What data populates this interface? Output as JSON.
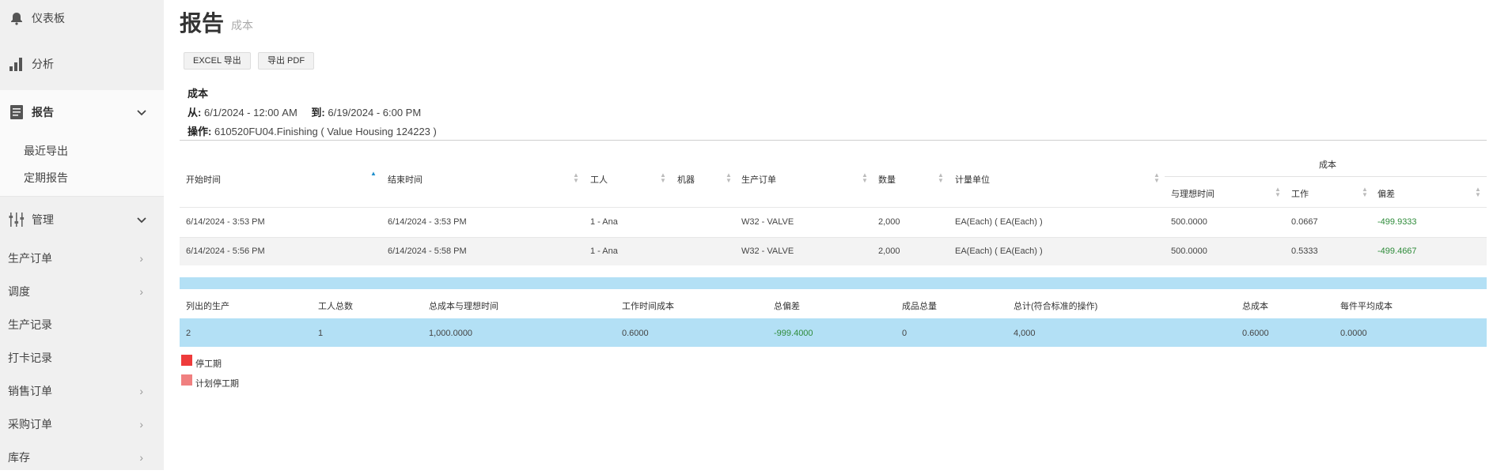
{
  "sidebar": {
    "dashboard": "仪表板",
    "analysis": "分析",
    "reports": "报告",
    "reports_sub": [
      "最近导出",
      "定期报告"
    ],
    "manage": "管理",
    "items": [
      "生产订单",
      "调度",
      "生产记录",
      "打卡记录",
      "销售订单",
      "采购订单",
      "库存"
    ]
  },
  "header": {
    "title": "报告",
    "subtitle": "成本"
  },
  "buttons": {
    "excel": "EXCEL 导出",
    "pdf": "导出 PDF"
  },
  "info": {
    "name": "成本",
    "from_label": "从:",
    "from_value": "6/1/2024 - 12:00 AM",
    "to_label": "到:",
    "to_value": "6/19/2024 - 6:00 PM",
    "op_label": "操作:",
    "op_value": "610520FU04.Finishing ( Value Housing 124223 )"
  },
  "table": {
    "group_header": "成本",
    "columns": [
      "开始时间",
      "结束时间",
      "工人",
      "机器",
      "生产订单",
      "数量",
      "计量单位"
    ],
    "sub_columns": [
      "与理想时间",
      "工作",
      "偏差"
    ],
    "rows": [
      [
        "6/14/2024 - 3:53 PM",
        "6/14/2024 - 3:53 PM",
        "1 - Ana",
        "",
        "W32 - VALVE",
        "2,000",
        "EA(Each) ( EA(Each) )",
        "500.0000",
        "0.0667",
        "-499.9333"
      ],
      [
        "6/14/2024 - 5:56 PM",
        "6/14/2024 - 5:58 PM",
        "1 - Ana",
        "",
        "W32 - VALVE",
        "2,000",
        "EA(Each) ( EA(Each) )",
        "500.0000",
        "0.5333",
        "-499.4667"
      ]
    ]
  },
  "summary": {
    "headers": [
      "列出的生产",
      "工人总数",
      "总成本与理想时间",
      "工作时间成本",
      "总偏差",
      "成品总量",
      "总计(符合标准的操作)",
      "总成本",
      "每件平均成本"
    ],
    "values": [
      "2",
      "1",
      "1,000.0000",
      "0.6000",
      "-999.4000",
      "0",
      "4,000",
      "0.6000",
      "0.0000"
    ]
  },
  "legend": [
    {
      "label": "停工期",
      "color": "#ee3b3b"
    },
    {
      "label": "计划停工期",
      "color": "#f08080"
    }
  ],
  "colors": {
    "accent": "#1e8fcc",
    "summary_bg": "#b3e0f5",
    "negative": "#2e8b3a"
  }
}
